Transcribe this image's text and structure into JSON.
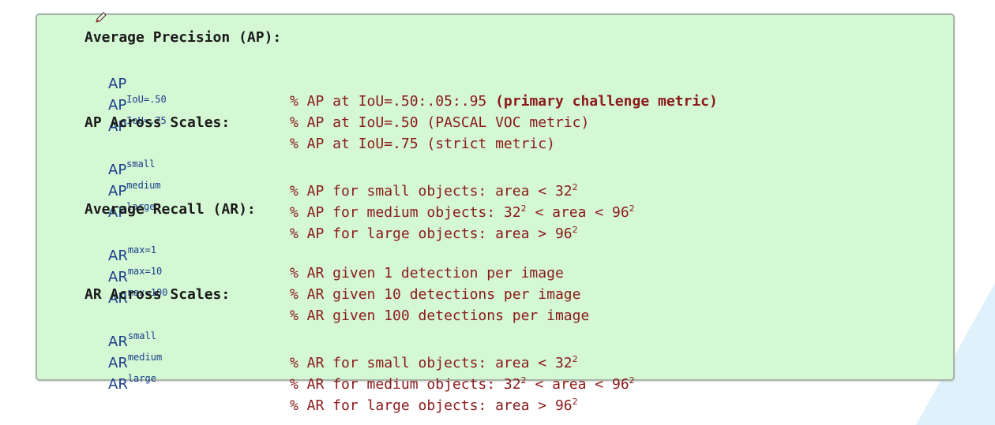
{
  "sections": [
    {
      "heading": "Average Precision (AP):",
      "rows": [
        {
          "base": "AP",
          "sup": "",
          "comment": "% AP at IoU=.50:.05:.95 ",
          "comment_bold": "(primary challenge metric)"
        },
        {
          "base": "AP",
          "sup": "IoU=.50",
          "comment": "% AP at IoU=.50 (PASCAL VOC metric)"
        },
        {
          "base": "AP",
          "sup": "IoU=.75",
          "comment": "% AP at IoU=.75 (strict metric)"
        }
      ]
    },
    {
      "heading": "AP Across Scales:",
      "rows": [
        {
          "base": "AP",
          "sup": "small",
          "comment_a": "% AP for small objects: area < 32",
          "exp_a": "2"
        },
        {
          "base": "AP",
          "sup": "medium",
          "comment_a": "% AP for medium objects: 32",
          "exp_a": "2",
          "comment_b": " < area < 96",
          "exp_b": "2"
        },
        {
          "base": "AP",
          "sup": "large",
          "comment_a": "% AP for large objects: area > 96",
          "exp_a": "2"
        }
      ]
    },
    {
      "heading": "Average Recall (AR):",
      "rows": [
        {
          "base": "AR",
          "sup": "max=1",
          "comment": "% AR given 1 detection per image"
        },
        {
          "base": "AR",
          "sup": "max=10",
          "comment": "% AR given 10 detections per image"
        },
        {
          "base": "AR",
          "sup": "max=100",
          "comment": "% AR given 100 detections per image"
        }
      ]
    },
    {
      "heading": "AR Across Scales:",
      "rows": [
        {
          "base": "AR",
          "sup": "small",
          "comment_a": "% AR for small objects: area < 32",
          "exp_a": "2"
        },
        {
          "base": "AR",
          "sup": "medium",
          "comment_a": "% AR for medium objects: 32",
          "exp_a": "2",
          "comment_b": " < area < 96",
          "exp_b": "2"
        },
        {
          "base": "AR",
          "sup": "large",
          "comment_a": "% AR for large objects: area > 96",
          "exp_a": "2"
        }
      ]
    }
  ],
  "colors": {
    "box_background": "#d4f7d4",
    "box_border": "#a8b4a8",
    "heading": "#1a1a1a",
    "metric": "#1a3e8a",
    "comment": "#8b1a1a"
  },
  "icons": {
    "cursor": "pencil-icon"
  }
}
